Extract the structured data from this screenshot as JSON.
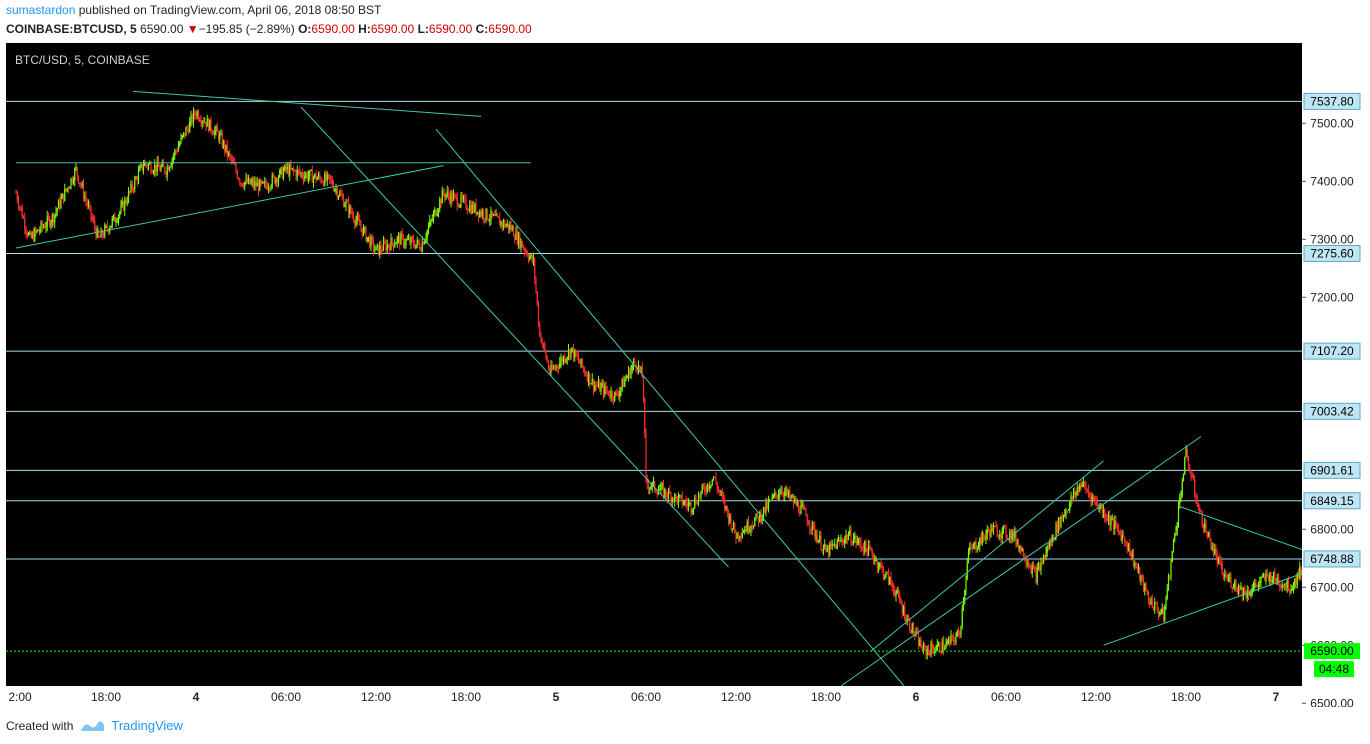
{
  "header": {
    "user": "sumastardon",
    "published_text": "published on TradingView.com, April 06, 2018 08:50 BST",
    "symbol": "COINBASE:BTCUSD, 5",
    "last": "6590.00",
    "change_arrow": "▼",
    "change": "−195.85 (−2.89%)",
    "o_label": "O:",
    "o_value": "6590.00",
    "h_label": "H:",
    "h_value": "6590.00",
    "l_label": "L:",
    "l_value": "6590.00",
    "c_label": "C:",
    "c_value": "6590.00"
  },
  "footer": {
    "created_with": "Created with",
    "brand": "TradingView"
  },
  "colors": {
    "background": "#000000",
    "up": "#7cfc00",
    "down": "#ff2d2d",
    "trendline": "#3ec9a7",
    "hline": "#a8dcee",
    "last_price": "#00ff00"
  },
  "chart_data": {
    "type": "candlestick",
    "title": "BTC/USD, 5, COINBASE",
    "ylim": [
      6480,
      7560
    ],
    "y_ticks": [
      6500,
      6600,
      6700,
      6800,
      7200,
      7300,
      7400,
      7500
    ],
    "y_tick_labels": [
      "6500.00",
      "6600.00",
      "6700.00",
      "6800.00",
      "7200.00",
      "7300.00",
      "7400.00",
      "7500.00"
    ],
    "x_ticks": [
      "2:00",
      "18:00",
      "4",
      "06:00",
      "12:00",
      "18:00",
      "5",
      "06:00",
      "12:00",
      "18:00",
      "6",
      "06:00",
      "12:00",
      "18:00",
      "7"
    ],
    "horizontal_levels": [
      7537.8,
      7275.6,
      7107.2,
      7003.42,
      6901.61,
      6849.15,
      6748.88
    ],
    "horizontal_level_labels": [
      "7537.80",
      "7275.60",
      "7107.20",
      "7003.42",
      "6901.61",
      "6849.15",
      "6748.88"
    ],
    "last_price": 6590.0,
    "last_price_label": "6590.00",
    "countdown": "04:48",
    "price_path": [
      [
        0,
        7380
      ],
      [
        0.9,
        7300
      ],
      [
        2.5,
        7340
      ],
      [
        4,
        7420
      ],
      [
        5.5,
        7300
      ],
      [
        7,
        7350
      ],
      [
        8.5,
        7430
      ],
      [
        10,
        7420
      ],
      [
        12,
        7520
      ],
      [
        13.5,
        7480
      ],
      [
        15,
        7400
      ],
      [
        16.5,
        7390
      ],
      [
        18,
        7420
      ],
      [
        19.5,
        7410
      ],
      [
        21,
        7400
      ],
      [
        22.5,
        7340
      ],
      [
        24,
        7280
      ],
      [
        25.5,
        7300
      ],
      [
        27,
        7290
      ],
      [
        28.5,
        7380
      ],
      [
        30,
        7360
      ],
      [
        31.5,
        7340
      ],
      [
        33,
        7320
      ],
      [
        34.5,
        7260
      ],
      [
        34.9,
        7140
      ],
      [
        35.6,
        7070
      ],
      [
        37,
        7110
      ],
      [
        38.5,
        7050
      ],
      [
        40,
        7030
      ],
      [
        41.3,
        7090
      ],
      [
        41.8,
        7060
      ],
      [
        42,
        6880
      ],
      [
        43.5,
        6860
      ],
      [
        45,
        6840
      ],
      [
        46.5,
        6890
      ],
      [
        48,
        6790
      ],
      [
        49.5,
        6820
      ],
      [
        51,
        6870
      ],
      [
        52.5,
        6830
      ],
      [
        54,
        6760
      ],
      [
        55.5,
        6790
      ],
      [
        57,
        6760
      ],
      [
        58.5,
        6700
      ],
      [
        59.5,
        6640
      ],
      [
        60.5,
        6590
      ],
      [
        62,
        6600
      ],
      [
        62.9,
        6620
      ],
      [
        63.5,
        6760
      ],
      [
        65,
        6800
      ],
      [
        66.5,
        6790
      ],
      [
        68,
        6720
      ],
      [
        69.5,
        6810
      ],
      [
        71,
        6880
      ],
      [
        72.5,
        6830
      ],
      [
        74,
        6780
      ],
      [
        75.5,
        6680
      ],
      [
        76.5,
        6650
      ],
      [
        77.3,
        6800
      ],
      [
        78,
        6930
      ],
      [
        79,
        6820
      ],
      [
        80.5,
        6720
      ],
      [
        82,
        6690
      ],
      [
        83.5,
        6720
      ],
      [
        85,
        6700
      ],
      [
        86.5,
        6770
      ],
      [
        88,
        6740
      ],
      [
        89.5,
        6730
      ],
      [
        91,
        6800
      ],
      [
        92.5,
        6820
      ],
      [
        94,
        6800
      ],
      [
        95.5,
        6790
      ],
      [
        97,
        6760
      ],
      [
        98.5,
        6800
      ],
      [
        100,
        6820
      ],
      [
        101.2,
        6800
      ],
      [
        101.5,
        6650
      ],
      [
        102.5,
        6580
      ],
      [
        103.5,
        6610
      ]
    ],
    "trendlines": [
      [
        [
          7.8,
          7555
        ],
        [
          31,
          7512
        ]
      ],
      [
        [
          0,
          7285
        ],
        [
          28.5,
          7427
        ]
      ],
      [
        [
          19,
          7528
        ],
        [
          47.5,
          6735
        ]
      ],
      [
        [
          28,
          7490
        ],
        [
          60.5,
          6490
        ]
      ],
      [
        [
          0,
          7432
        ],
        [
          34.3,
          7432
        ]
      ],
      [
        [
          57,
          6590
        ],
        [
          72.5,
          6918
        ]
      ],
      [
        [
          55,
          6530
        ],
        [
          79,
          6960
        ]
      ],
      [
        [
          72.5,
          6600
        ],
        [
          103.5,
          6890
        ]
      ],
      [
        [
          86,
          6610
        ],
        [
          107.5,
          6830
        ]
      ],
      [
        [
          77.5,
          6840
        ],
        [
          94,
          6690
        ]
      ]
    ],
    "grid": false,
    "legend": "none"
  }
}
